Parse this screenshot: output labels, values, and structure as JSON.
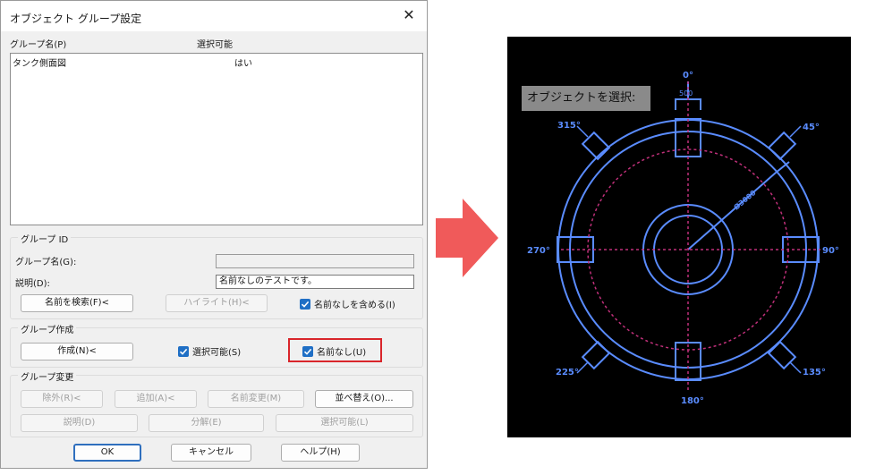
{
  "dialog": {
    "title": "オブジェクト グループ設定",
    "close_glyph": "✕",
    "list": {
      "headers": {
        "name": "グループ名(P)",
        "selectable": "選択可能"
      },
      "rows": [
        {
          "name": "タンク側面図",
          "selectable": "はい"
        }
      ]
    },
    "group_id": {
      "legend": "グループ ID",
      "name_label": "グループ名(G):",
      "name_value": "",
      "desc_label": "説明(D):",
      "desc_value": "名前なしのテストです。",
      "find_button": "名前を検索(F)<",
      "highlight_button": "ハイライト(H)<",
      "include_unnamed": "名前なしを含める(I)"
    },
    "create_group": {
      "legend": "グループ作成",
      "create_button": "作成(N)<",
      "selectable_check": "選択可能(S)",
      "unnamed_check": "名前なし(U)"
    },
    "change_group": {
      "legend": "グループ変更",
      "remove_button": "除外(R)<",
      "add_button": "追加(A)<",
      "rename_button": "名前変更(M)",
      "reorder_button": "並べ替え(O)...",
      "description_button": "説明(D)",
      "explode_button": "分解(E)",
      "selectable_button": "選択可能(L)"
    },
    "footer": {
      "ok": "OK",
      "cancel": "キャンセル",
      "help": "ヘルプ(H)"
    }
  },
  "colors": {
    "highlight_red": "#d9252a",
    "arrow": "#f05a5a",
    "checkbox": "#1f6fc5",
    "cad_line": "#5a8cff",
    "cad_dash": "#c0307a"
  },
  "cad": {
    "prompt": "オブジェクトを選択:",
    "angles": {
      "top": "0°",
      "left": "270°",
      "right": "90°",
      "bottom": "180°",
      "top_left": "315°",
      "top_right": "45°",
      "bottom_left": "225°",
      "bottom_right": "135°"
    },
    "dim_top": "500",
    "dim_diag": "Ø3000"
  }
}
